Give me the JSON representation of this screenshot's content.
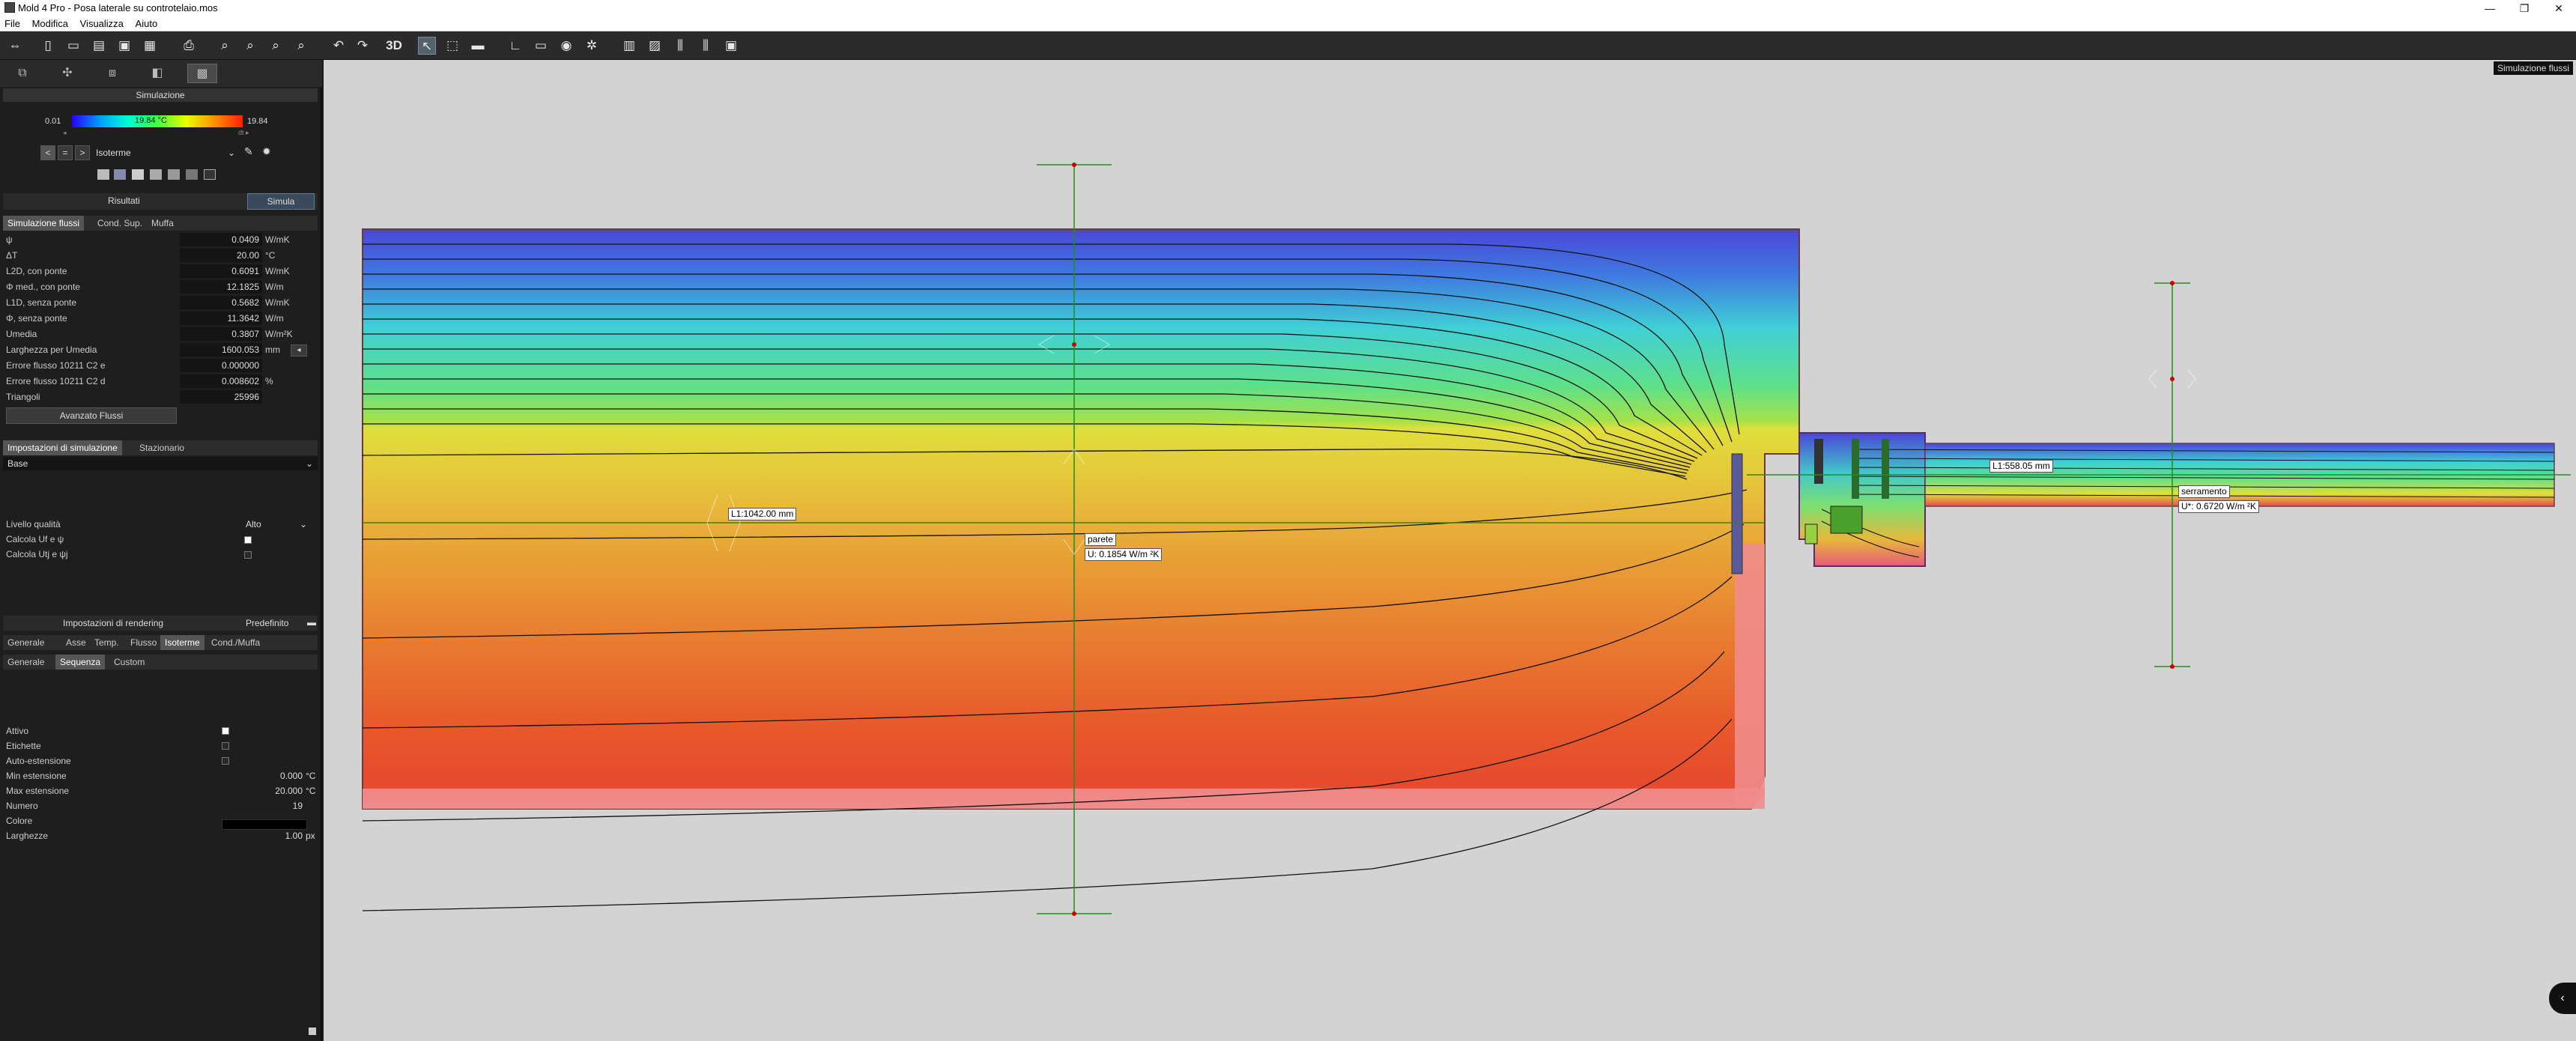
{
  "window": {
    "title": "Mold 4 Pro - Posa laterale su controtelaio.mos",
    "controls": [
      "—",
      "❐",
      "✕"
    ]
  },
  "menu": [
    "File",
    "Modifica",
    "Visualizza",
    "Aiuto"
  ],
  "toolbar": {
    "btn_3d": "3D",
    "icons": [
      "arrows-icon",
      "new-icon",
      "open-icon",
      "folder-icon",
      "save-icon",
      "save-as-icon",
      "print-icon",
      "zoom-fit-icon",
      "zoom-in-icon",
      "zoom-out-icon",
      "zoom-window-icon",
      "undo-icon",
      "redo-icon",
      "select-icon",
      "cursor-icon",
      "ruler-icon",
      "corner-icon",
      "comment-icon",
      "eye-icon",
      "mesh-icon",
      "chart-icon",
      "chart2-icon",
      "chart3-icon",
      "chart4-icon",
      "report-icon"
    ]
  },
  "simulation_panel": {
    "title": "Simulazione",
    "scale_min": "0.01",
    "scale_max": "19.84",
    "scale_mid": "19.84 °C",
    "scale_small_left": "◂",
    "scale_small_right": "dt ▸",
    "mode_select": "Isoterme",
    "tab_results": "Risultati",
    "tab_simulate": "Simula"
  },
  "results_tabs": [
    "Simulazione flussi",
    "Cond. Sup.",
    "Muffa"
  ],
  "results": [
    {
      "label": "ψ",
      "value": "0.0409",
      "unit": "W/mK"
    },
    {
      "label": "ΔT",
      "value": "20.00",
      "unit": "°C"
    },
    {
      "label": "L2D, con ponte",
      "value": "0.6091",
      "unit": "W/mK"
    },
    {
      "label": "Φ med., con ponte",
      "value": "12.1825",
      "unit": "W/m"
    },
    {
      "label": "L1D, senza ponte",
      "value": "0.5682",
      "unit": "W/mK"
    },
    {
      "label": "Φ, senza ponte",
      "value": "11.3642",
      "unit": "W/m"
    },
    {
      "label": "Umedia",
      "value": "0.3807",
      "unit": "W/m²K"
    },
    {
      "label": "Larghezza per Umedia",
      "value": "1600.053",
      "unit": "mm"
    },
    {
      "label": "Errore flusso 10211 C2 e",
      "value": "0.000000",
      "unit": ""
    },
    {
      "label": "Errore flusso 10211 C2 d",
      "value": "0.008602",
      "unit": "%"
    },
    {
      "label": "Triangoli",
      "value": "25996",
      "unit": ""
    }
  ],
  "advanced_button": "Avanzato Flussi",
  "sim_settings": {
    "tabs": [
      "Impostazioni di simulazione",
      "Stazionario"
    ],
    "base": "Base",
    "quality_label": "Livello qualità",
    "quality_value": "Alto",
    "calc1": "Calcola Uf e ψ",
    "calc2": "Calcola Utj e ψj"
  },
  "rendering": {
    "title": "Impostazioni di rendering",
    "preset": "Predefinito",
    "tabs": [
      "Generale",
      "Asse",
      "Temp.",
      "Flusso",
      "Isoterme",
      "Cond./Muffa"
    ],
    "subtabs": [
      "Generale",
      "Sequenza",
      "Custom"
    ],
    "rows": [
      {
        "label": "Attivo",
        "value": ""
      },
      {
        "label": "Etichette",
        "value": ""
      },
      {
        "label": "Auto-estensione",
        "value": ""
      },
      {
        "label": "Min estensione",
        "value": "0.000",
        "unit": "°C"
      },
      {
        "label": "Max estensione",
        "value": "20.000",
        "unit": "°C"
      },
      {
        "label": "Numero",
        "value": "19",
        "unit": ""
      },
      {
        "label": "Colore",
        "value": "",
        "unit": ""
      },
      {
        "label": "Larghezze",
        "value": "1.00",
        "unit": "px"
      }
    ]
  },
  "viewport": {
    "status": "Simulazione flussi",
    "labels": {
      "l1": "L1:1042.00 mm",
      "parete": "parete",
      "u_parete": "U: 0.1854 W/m ²K",
      "l2": "L1:558.05 mm",
      "serramento": "serramento",
      "u_serr": "U*: 0.6720 W/m ²K"
    }
  },
  "colors": {
    "cold": "#3f4fd8",
    "mid": "#d9e23a",
    "warm": "#e65a2c",
    "hot": "#f08a8a",
    "accent": "#4b8cc8"
  }
}
